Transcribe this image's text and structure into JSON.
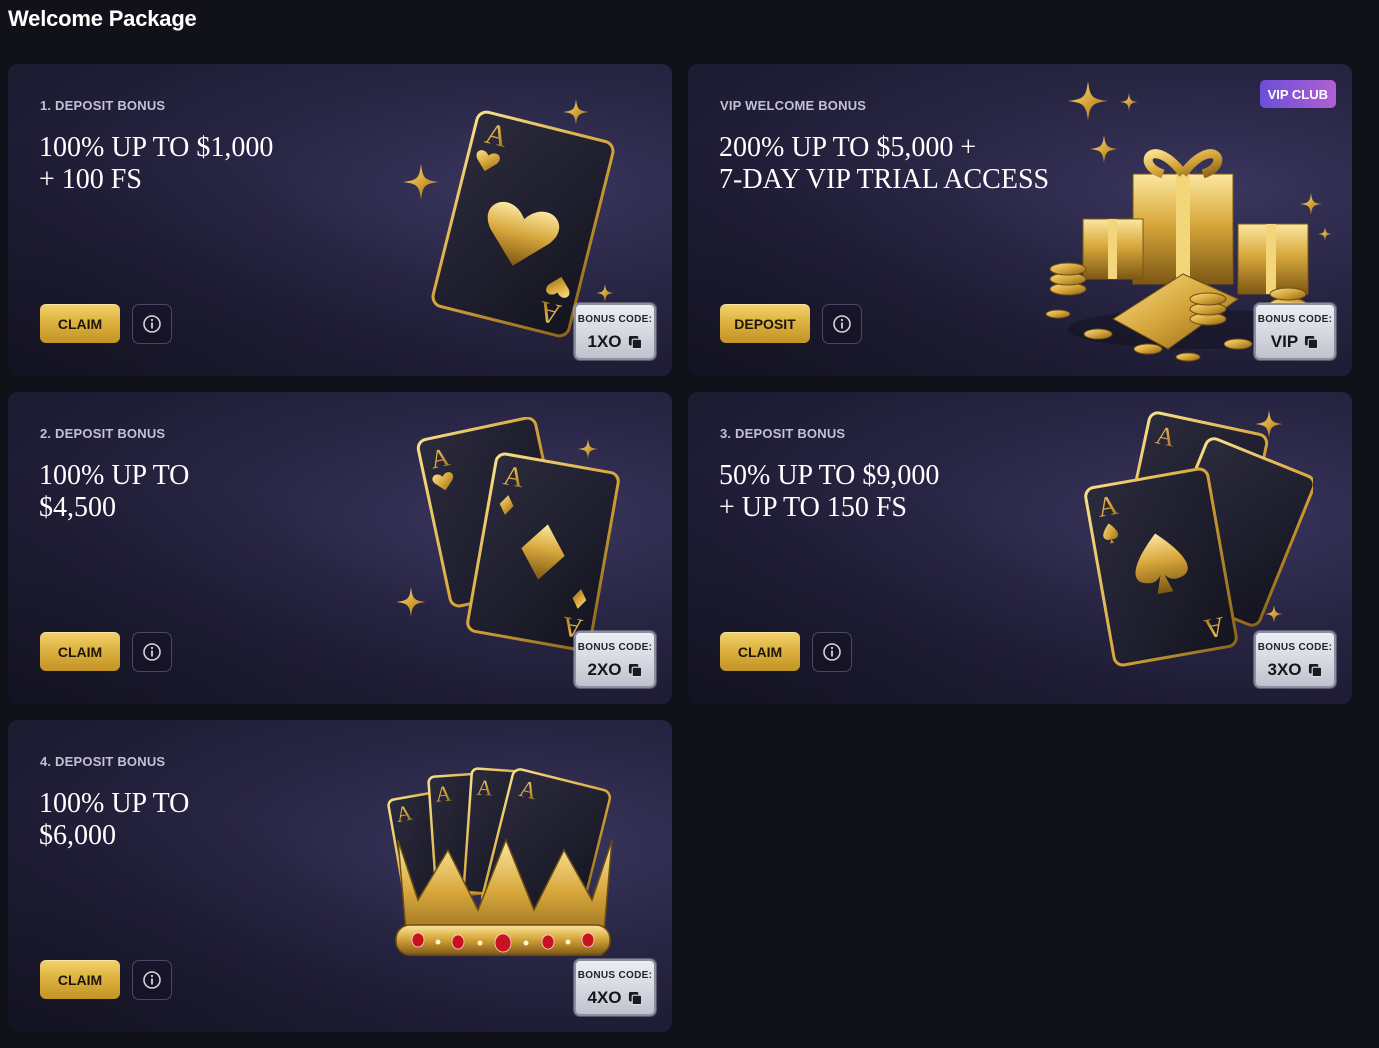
{
  "page": {
    "title": "Welcome Package"
  },
  "cards": [
    {
      "kicker": "1. DEPOSIT BONUS",
      "headline": [
        "100% UP TO $1,000",
        "+ 100 FS"
      ],
      "action_label": "CLAIM",
      "code_label": "BONUS CODE:",
      "code": "1XO",
      "art": "ace-of-hearts-card"
    },
    {
      "kicker": "VIP WELCOME BONUS",
      "badge": "VIP CLUB",
      "headline": [
        "200% UP TO $5,000 +",
        "7-DAY VIP TRIAL ACCESS"
      ],
      "action_label": "DEPOSIT",
      "code_label": "BONUS CODE:",
      "code": "VIP",
      "art": "gold-gifts-and-coins"
    },
    {
      "kicker": "2. DEPOSIT BONUS",
      "headline": [
        "100% UP TO",
        "$4,500"
      ],
      "action_label": "CLAIM",
      "code_label": "BONUS CODE:",
      "code": "2XO",
      "art": "two-aces-cards"
    },
    {
      "kicker": "3. DEPOSIT BONUS",
      "headline": [
        "50% UP TO $9,000",
        "+ UP TO 150 FS"
      ],
      "action_label": "CLAIM",
      "code_label": "BONUS CODE:",
      "code": "3XO",
      "art": "three-aces-cards"
    },
    {
      "kicker": "4. DEPOSIT BONUS",
      "headline": [
        "100% UP TO",
        "$6,000"
      ],
      "action_label": "CLAIM",
      "code_label": "BONUS CODE:",
      "code": "4XO",
      "art": "aces-in-gold-crown"
    }
  ],
  "colors": {
    "background": "#111119",
    "card": "#2a2747",
    "gold": "#d9ad3b",
    "vip_badge": "#8a57d6"
  }
}
